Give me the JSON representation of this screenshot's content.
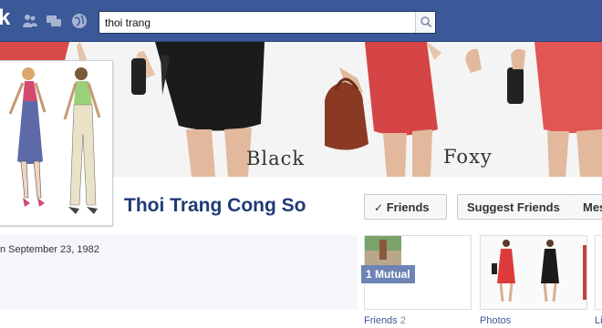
{
  "header": {
    "logo_fragment": "k",
    "search_value": "thoi trang",
    "icons": [
      "friend-requests-icon",
      "messages-icon",
      "notifications-globe-icon",
      "search-icon"
    ]
  },
  "cover": {
    "label_left": "Black",
    "label_right": "Foxy"
  },
  "profile": {
    "name": "Thoi Trang Cong So",
    "birthday_text": "n September 23, 1982"
  },
  "actions": {
    "friends_label": "Friends",
    "suggest_label": "Suggest Friends",
    "message_label": "Mes"
  },
  "apps": {
    "mutual_badge": "1 Mutual",
    "friends_label": "Friends",
    "friends_count": "2",
    "photos_label": "Photos",
    "likes_label": "Li"
  },
  "colors": {
    "brand_blue": "#3b5998",
    "name_blue": "#1f3b73",
    "skirt_red": "#d94a4a",
    "skirt_black": "#1b1b1b"
  }
}
